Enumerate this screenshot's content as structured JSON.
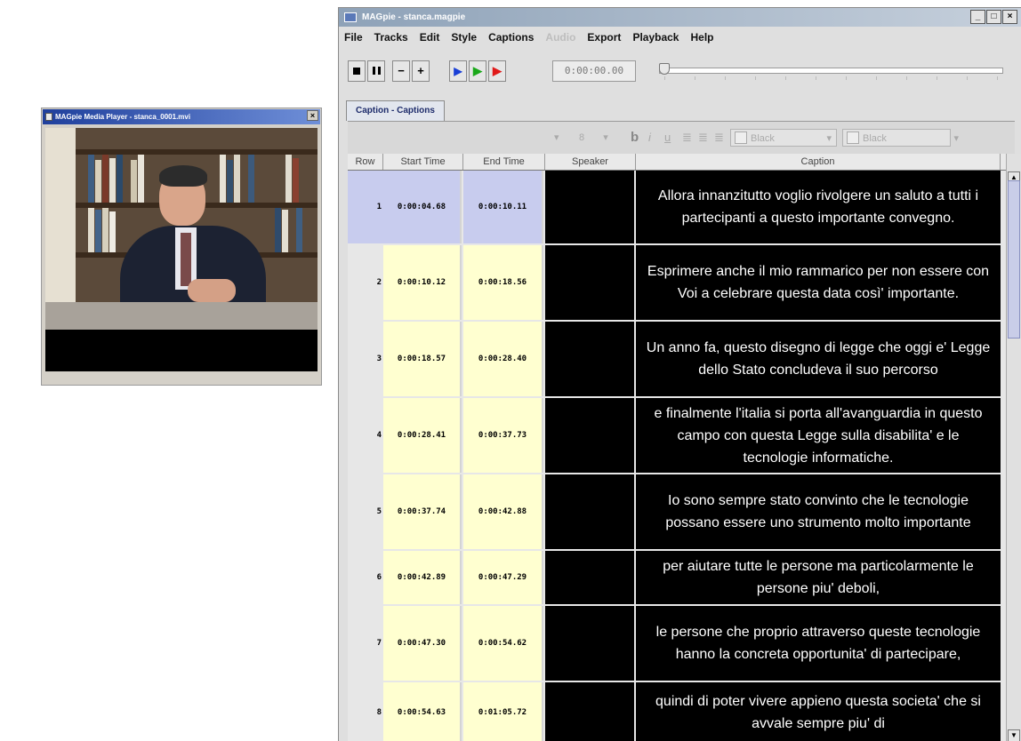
{
  "player": {
    "title": "MAGpie Media Player - stanca_0001.mvi",
    "close": "×"
  },
  "window": {
    "title": "MAGpie - stanca.magpie",
    "min": "_",
    "max": "□",
    "close": "×"
  },
  "menu": {
    "file": "File",
    "tracks": "Tracks",
    "edit": "Edit",
    "style": "Style",
    "captions": "Captions",
    "audio": "Audio",
    "export": "Export",
    "playback": "Playback",
    "help": "Help"
  },
  "toolbar": {
    "minus": "−",
    "plus": "+",
    "time": "0:00:00.00",
    "slider_position": 0.0,
    "play_icons": [
      "play-blue-icon",
      "play-green-icon",
      "play-red-icon"
    ]
  },
  "tab": {
    "label": "Caption - Captions"
  },
  "format": {
    "size": "8",
    "bold": "b",
    "italic": "i",
    "underline": "u",
    "fg_color": "Black",
    "bg_color": "Black"
  },
  "table": {
    "headers": {
      "row": "Row",
      "start": "Start Time",
      "end": "End Time",
      "speaker": "Speaker",
      "caption": "Caption"
    },
    "rows": [
      {
        "num": "1",
        "start": "0:00:04.68",
        "end": "0:00:10.11",
        "caption": "Allora innanzitutto voglio rivolgere un saluto a tutti i partecipanti a questo importante convegno."
      },
      {
        "num": "2",
        "start": "0:00:10.12",
        "end": "0:00:18.56",
        "caption": "Esprimere anche il mio rammarico per non essere con Voi a celebrare questa data così' importante."
      },
      {
        "num": "3",
        "start": "0:00:18.57",
        "end": "0:00:28.40",
        "caption": "Un anno fa, questo disegno di legge che oggi e' Legge dello Stato concludeva il suo percorso"
      },
      {
        "num": "4",
        "start": "0:00:28.41",
        "end": "0:00:37.73",
        "caption": "e finalmente l'italia si porta all'avanguardia in questo campo con questa Legge sulla disabilita' e le tecnologie informatiche."
      },
      {
        "num": "5",
        "start": "0:00:37.74",
        "end": "0:00:42.88",
        "caption": "Io sono sempre stato convinto che le tecnologie possano essere uno strumento molto importante"
      },
      {
        "num": "6",
        "start": "0:00:42.89",
        "end": "0:00:47.29",
        "caption": "per aiutare tutte le persone ma particolarmente le persone piu' deboli,"
      },
      {
        "num": "7",
        "start": "0:00:47.30",
        "end": "0:00:54.62",
        "caption": "le persone che proprio attraverso queste tecnologie hanno la concreta opportunita' di partecipare,"
      },
      {
        "num": "8",
        "start": "0:00:54.63",
        "end": "0:01:05.72",
        "caption": "quindi di poter vivere appieno questa societa' che si avvale sempre piu' di"
      }
    ]
  },
  "colors": {
    "selected_row": "#c8ccee",
    "time_cell": "#ffffd0",
    "caption_bg": "#000000",
    "caption_fg": "#ffffff"
  }
}
